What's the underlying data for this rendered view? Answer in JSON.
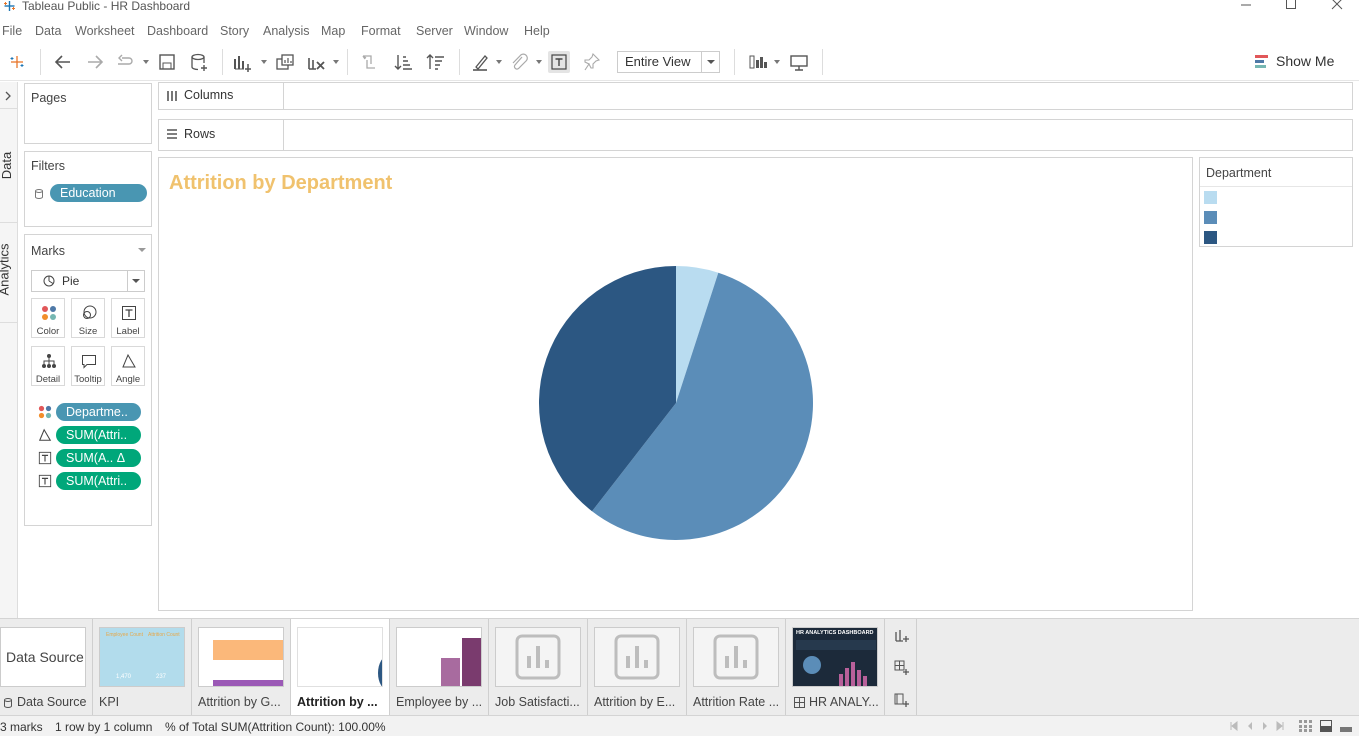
{
  "window": {
    "title": "Tableau Public - HR Dashboard",
    "controls": [
      "minimize",
      "maximize",
      "close"
    ]
  },
  "menu": [
    "File",
    "Data",
    "Worksheet",
    "Dashboard",
    "Story",
    "Analysis",
    "Map",
    "Format",
    "Server",
    "Window",
    "Help"
  ],
  "toolbar": {
    "fit_value": "Entire View",
    "show_me_label": "Show Me"
  },
  "left_tabs": {
    "data_label": "Data",
    "analytics_label": "Analytics"
  },
  "pages_card": {
    "title": "Pages"
  },
  "filters_card": {
    "title": "Filters",
    "pills": [
      "Education"
    ]
  },
  "marks_card": {
    "title": "Marks",
    "mark_type": "Pie",
    "buttons": [
      "Color",
      "Size",
      "Label",
      "Detail",
      "Tooltip",
      "Angle"
    ],
    "pills": [
      {
        "label": "Departme..",
        "type": "color"
      },
      {
        "label": "SUM(Attri..",
        "type": "angle"
      },
      {
        "label": "SUM(A..  Δ",
        "type": "label"
      },
      {
        "label": "SUM(Attri..",
        "type": "label"
      }
    ]
  },
  "shelves": {
    "columns_label": "Columns",
    "rows_label": "Rows"
  },
  "sheet": {
    "title": "Attrition by Department",
    "title_color": "#f0c26e"
  },
  "legend": {
    "title": "Department",
    "items": [
      {
        "label": "",
        "color": "#b9dcf0"
      },
      {
        "label": "",
        "color": "#5b8db8"
      },
      {
        "label": "",
        "color": "#2c5782"
      }
    ]
  },
  "chart_data": {
    "type": "pie",
    "title": "Attrition by Department",
    "legend_title": "Department",
    "legend_position": "right",
    "slices": [
      {
        "label": "",
        "value": 5.0,
        "color": "#b9dcf0"
      },
      {
        "label": "",
        "value": 55.5,
        "color": "#5b8db8"
      },
      {
        "label": "",
        "value": 39.5,
        "color": "#2c5782"
      }
    ]
  },
  "sheet_tabs": [
    {
      "label": "Data Source",
      "thumb_text": "Data Source",
      "kind": "datasource",
      "active": false
    },
    {
      "label": "KPI",
      "kind": "kpi",
      "active": false,
      "thumb_text_1": "Employee Count",
      "thumb_text_2": "Attrition Count",
      "thumb_value_1": "1,470",
      "thumb_value_2": "237"
    },
    {
      "label": "Attrition by G...",
      "kind": "bars",
      "active": false
    },
    {
      "label": "Attrition by ...",
      "kind": "pie",
      "active": true
    },
    {
      "label": "Employee by ...",
      "kind": "columns",
      "active": false
    },
    {
      "label": "Job Satisfacti...",
      "kind": "placeholder",
      "active": false
    },
    {
      "label": "Attrition by E...",
      "kind": "placeholder",
      "active": false
    },
    {
      "label": "Attrition Rate ...",
      "kind": "placeholder",
      "active": false
    },
    {
      "label": "HR ANALY...",
      "kind": "dashboard",
      "active": false,
      "thumb_text": "HR ANALYTICS DASHBOARD"
    }
  ],
  "status": {
    "marks": "3 marks",
    "dimensions": "1 row by 1 column",
    "summary": "% of Total SUM(Attrition Count): 100.00%"
  },
  "colors": {
    "pill_dimension": "#4996b2",
    "pill_measure": "#00a77a"
  }
}
